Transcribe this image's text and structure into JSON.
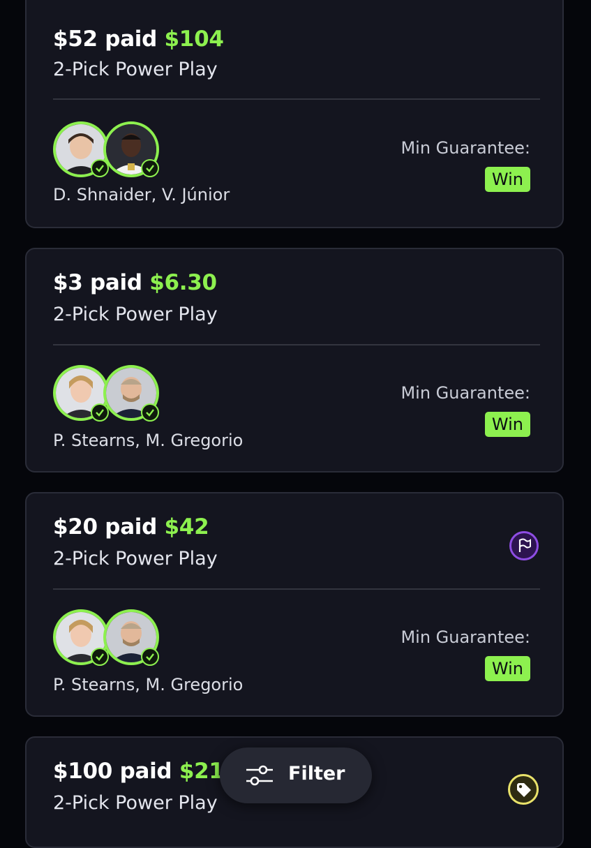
{
  "filter": {
    "label": "Filter",
    "icon": "sliders-icon"
  },
  "entries": [
    {
      "paid": "$52 paid",
      "payout": "$104",
      "play_type": "2-Pick Power Play",
      "players": "D. Shnaider, V. Júnior",
      "guarantee_label": "Min Guarantee:",
      "guarantee_value": "Win",
      "badge_icon": null
    },
    {
      "paid": "$3 paid",
      "payout": "$6.30",
      "play_type": "2-Pick Power Play",
      "players": "P. Stearns, M. Gregorio",
      "guarantee_label": "Min Guarantee:",
      "guarantee_value": "Win",
      "badge_icon": null
    },
    {
      "paid": "$20 paid",
      "payout": "$42",
      "play_type": "2-Pick Power Play",
      "players": "P. Stearns, M. Gregorio",
      "guarantee_label": "Min Guarantee:",
      "guarantee_value": "Win",
      "badge_icon": "flag-icon"
    },
    {
      "paid": "$100 paid",
      "payout": "$210",
      "play_type": "2-Pick Power Play",
      "badge_icon": "tag-icon"
    }
  ],
  "colors": {
    "accent": "#8df04f",
    "card_bg": "#14151f",
    "page_bg": "#05060b",
    "flag_purple": "#8e4de3",
    "tag_yellow": "#e9e26a"
  }
}
